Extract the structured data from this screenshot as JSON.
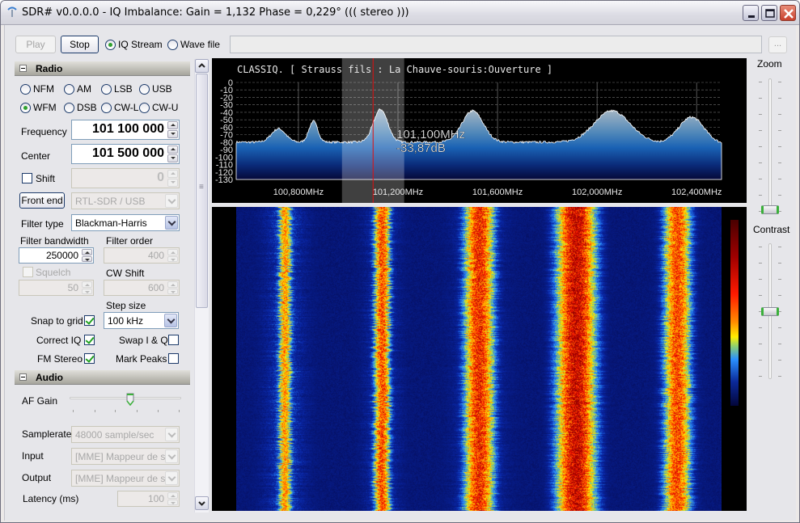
{
  "window": {
    "title": "SDR# v0.0.0.0 - IQ Imbalance: Gain = 1,132 Phase = 0,229° ((( stereo )))",
    "minimize_icon": "minimize-icon",
    "maximize_icon": "maximize-icon",
    "close_icon": "close-icon"
  },
  "toolbar": {
    "play_label": "Play",
    "stop_label": "Stop",
    "source_options": [
      {
        "label": "IQ Stream",
        "selected": true
      },
      {
        "label": "Wave file",
        "selected": false
      }
    ],
    "file_path_value": "",
    "browse_label": "..."
  },
  "radio": {
    "header": "Radio",
    "modes": [
      {
        "label": "NFM",
        "selected": false
      },
      {
        "label": "AM",
        "selected": false
      },
      {
        "label": "LSB",
        "selected": false
      },
      {
        "label": "USB",
        "selected": false
      },
      {
        "label": "WFM",
        "selected": true
      },
      {
        "label": "DSB",
        "selected": false
      },
      {
        "label": "CW-L",
        "selected": false
      },
      {
        "label": "CW-U",
        "selected": false
      }
    ],
    "frequency_label": "Frequency",
    "frequency_value": "101 100 000",
    "center_label": "Center",
    "center_value": "101 500 000",
    "shift_label": "Shift",
    "shift_checked": false,
    "shift_value": "0",
    "front_end_label": "Front end",
    "front_end_value": "RTL-SDR / USB",
    "filter_type_label": "Filter type",
    "filter_type_value": "Blackman-Harris",
    "filter_bandwidth_label": "Filter bandwidth",
    "filter_bandwidth_value": "250000",
    "filter_order_label": "Filter order",
    "filter_order_value": "400",
    "squelch_label": "Squelch",
    "squelch_checked": false,
    "squelch_value": "50",
    "cw_shift_label": "CW Shift",
    "cw_shift_value": "600",
    "step_size_label": "Step size",
    "step_size_value": "100 kHz",
    "snap_to_grid_label": "Snap to grid",
    "snap_to_grid_checked": true,
    "correct_iq_label": "Correct IQ",
    "correct_iq_checked": true,
    "swap_iq_label": "Swap I & Q",
    "swap_iq_checked": false,
    "fm_stereo_label": "FM Stereo",
    "fm_stereo_checked": true,
    "mark_peaks_label": "Mark Peaks",
    "mark_peaks_checked": false
  },
  "audio": {
    "header": "Audio",
    "af_gain_label": "AF Gain",
    "af_gain_fraction": 0.55,
    "samplerate_label": "Samplerate",
    "samplerate_value": "48000 sample/sec",
    "input_label": "Input",
    "input_value": "[MME] Mappeur de son",
    "output_label": "Output",
    "output_value": "[MME] Mappeur de son",
    "latency_label": "Latency (ms)",
    "latency_value": "100"
  },
  "spectrum": {
    "rds_text": "CLASSIQ. [ Strauss fils : La Chauve-souris:Ouverture ]",
    "db_ticks": [
      "0",
      "-10",
      "-20",
      "-30",
      "-40",
      "-50",
      "-60",
      "-70",
      "-80",
      "-90",
      "-100",
      "-110",
      "-120",
      "-130"
    ],
    "freq_ticks": [
      "100,800MHz",
      "101,200MHz",
      "101,600MHz",
      "102,000MHz",
      "102,400MHz"
    ],
    "cursor_freq": "101,100MHz",
    "cursor_level": "-33,87dB",
    "colors": {
      "fill_top": "#8aa7bd",
      "fill_mid": "#1c63b4",
      "fill_bottom": "#05093a",
      "cursor": "#e01010"
    }
  },
  "right_panel": {
    "zoom_label": "Zoom",
    "zoom_fraction": 0.0,
    "contrast_label": "Contrast",
    "contrast_fraction": 0.5
  }
}
